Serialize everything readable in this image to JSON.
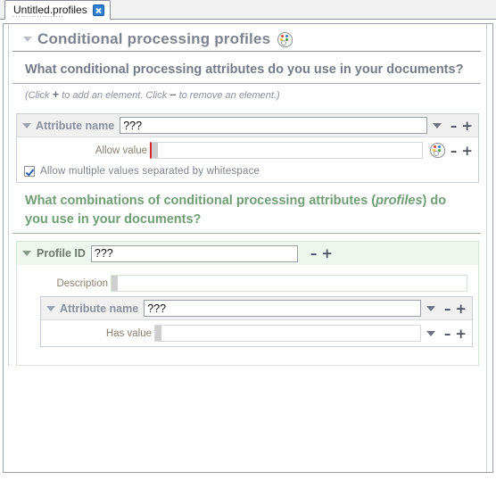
{
  "tab": {
    "label": "Untitled.profiles",
    "close_icon": "close-icon"
  },
  "document": {
    "title": "Conditional processing profiles",
    "title_icon": "palette-icon",
    "collapse_icon": "triangle-down-icon"
  },
  "sections": [
    {
      "heading": "What conditional processing attributes do you use in your documents?",
      "hint_prefix": "(Click ",
      "hint_plus": "+",
      "hint_mid": " to add an element. Click ",
      "hint_minus": "–",
      "hint_suffix": " to remove an element.)",
      "attribute": {
        "label": "Attribute name",
        "value": "???",
        "dropdown_icon": "chevron-down-icon",
        "remove_label": "–",
        "add_label": "+",
        "allow_value": {
          "label": "Allow value",
          "value": "",
          "palette_icon": "palette-icon",
          "remove_label": "–",
          "add_label": "+"
        },
        "checkbox": {
          "label": "Allow multiple values separated by whitespace",
          "checked": true
        }
      }
    },
    {
      "heading_part1": "What combinations of conditional processing attributes (",
      "heading_em": "profiles",
      "heading_part2": ") do you use in your documents?",
      "profile": {
        "label": "Profile ID",
        "value": "???",
        "remove_label": "–",
        "add_label": "+",
        "description": {
          "label": "Description",
          "value": ""
        },
        "attribute": {
          "label": "Attribute name",
          "value": "???",
          "dropdown_icon": "chevron-down-icon",
          "remove_label": "–",
          "add_label": "+",
          "has_value": {
            "label": "Has value",
            "value": "",
            "dropdown_icon": "chevron-down-icon",
            "remove_label": "–",
            "add_label": "+"
          }
        }
      }
    }
  ],
  "colors": {
    "heading_grey": "#757c88",
    "heading_green": "#6f9e74",
    "green_bg": "#eef7ee",
    "grey_bg": "#f0f0f0",
    "accent_blue": "#2f7fd1",
    "error_red": "#d2251f"
  }
}
